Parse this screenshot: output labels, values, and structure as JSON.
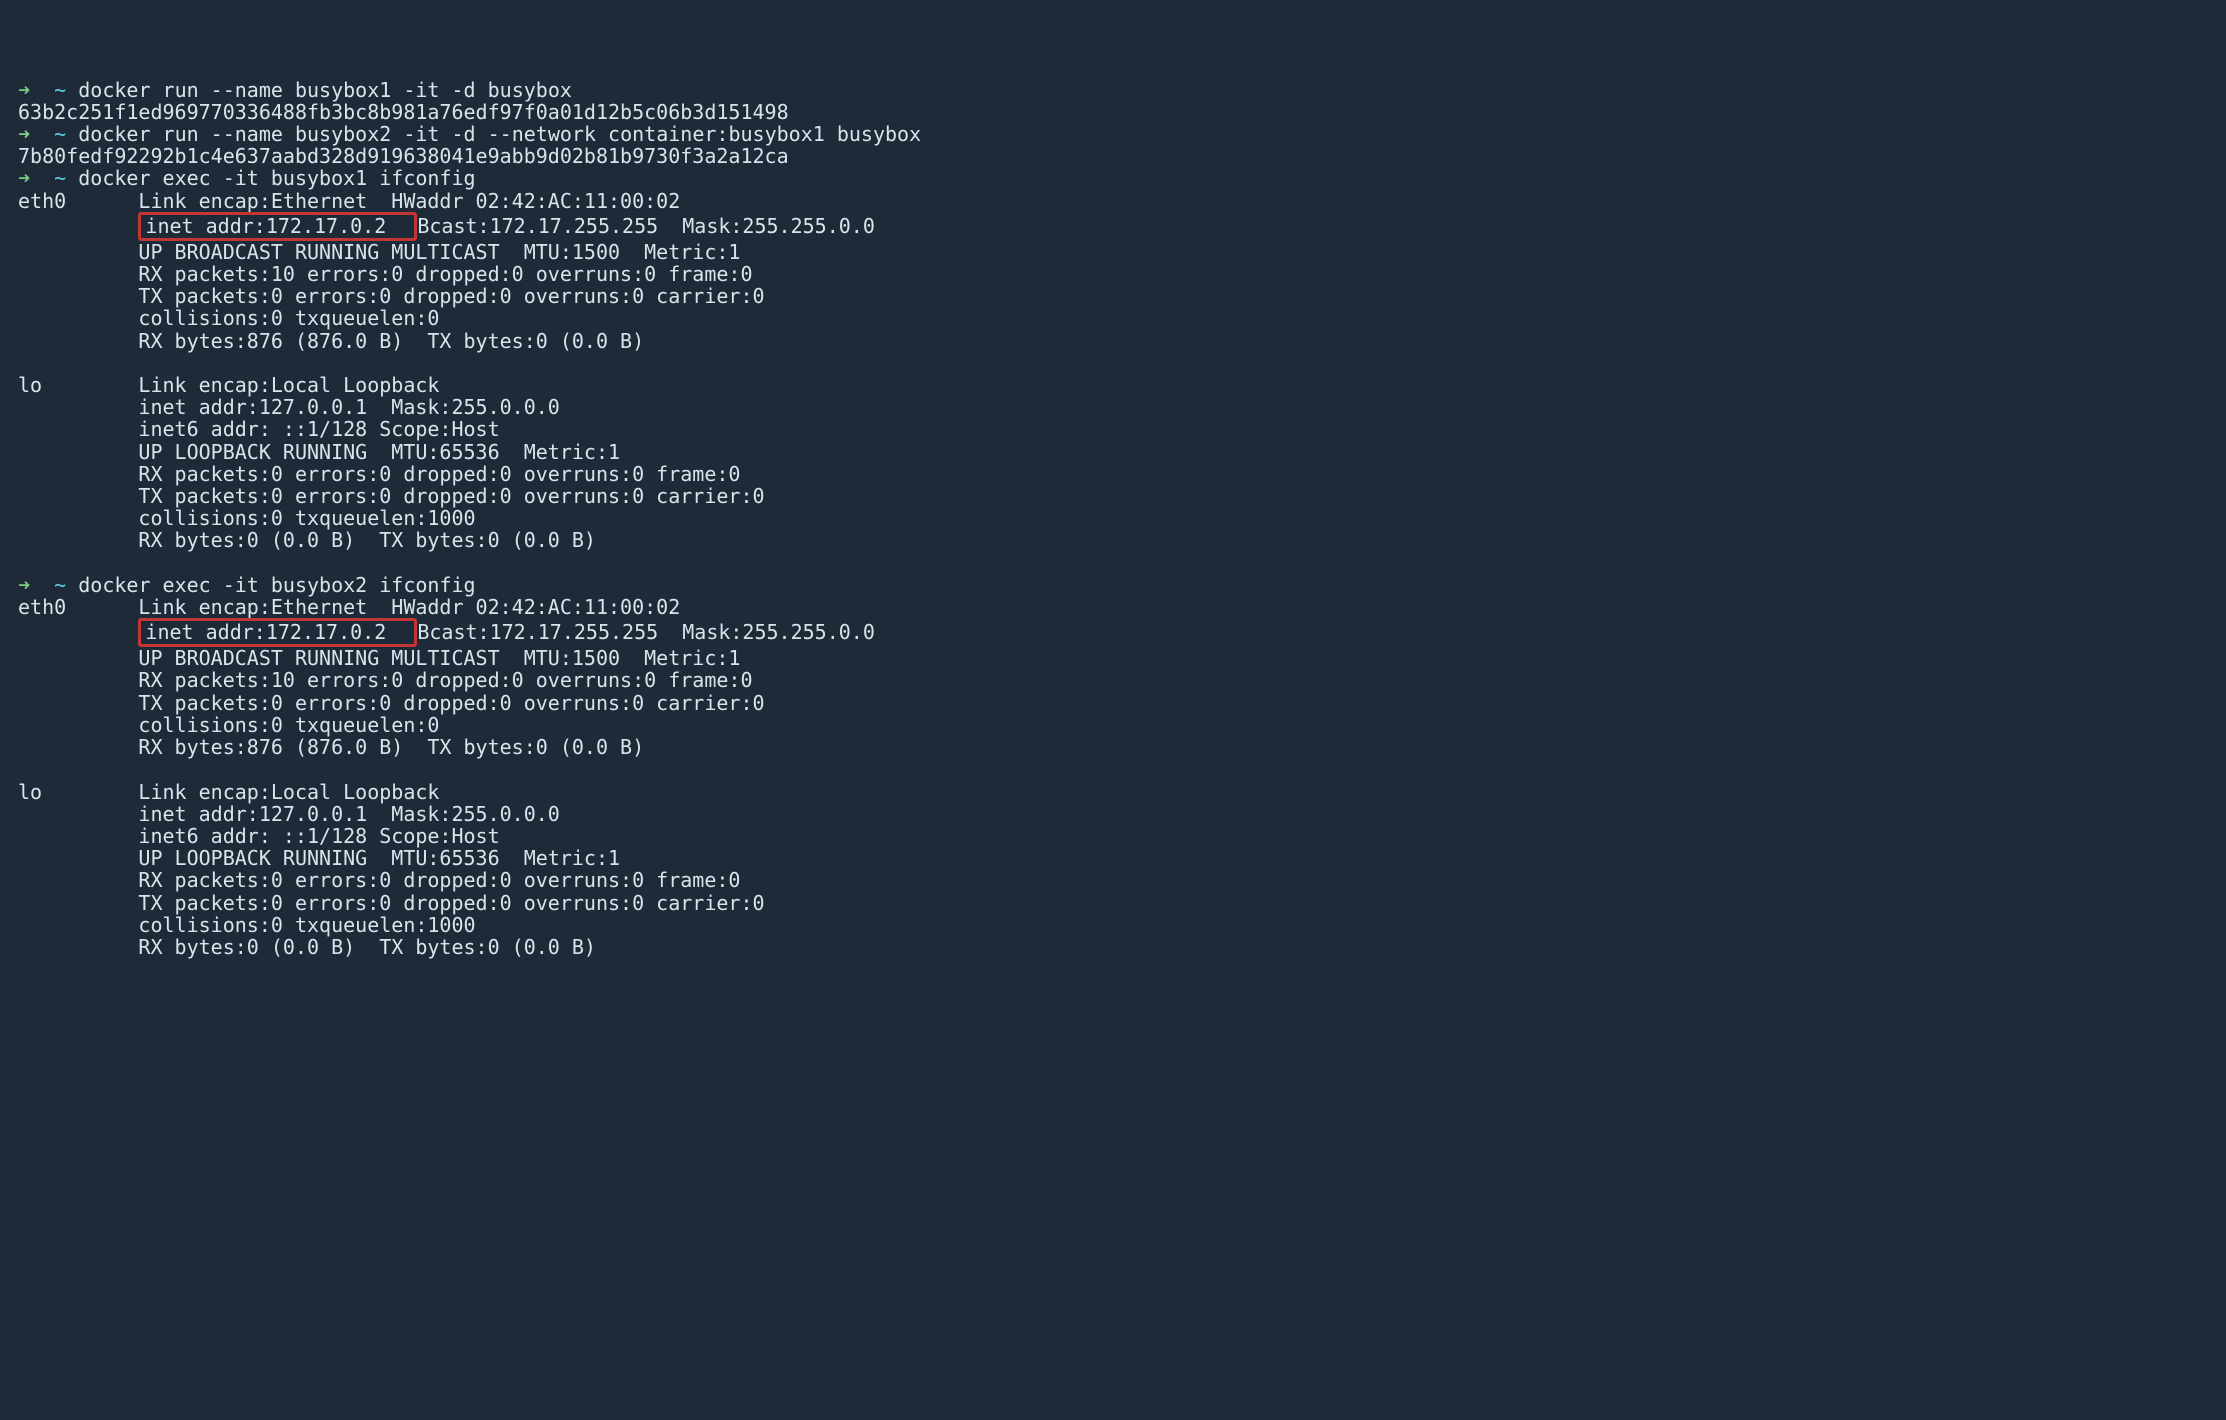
{
  "prompt": {
    "arrow": "➜",
    "tilde": "~"
  },
  "cmd1": "docker run --name busybox1 -it -d busybox",
  "out1": "63b2c251f1ed969770336488fb3bc8b981a76edf97f0a01d12b5c06b3d151498",
  "cmd2": "docker run --name busybox2 -it -d --network container:busybox1 busybox",
  "out2": "7b80fedf92292b1c4e637aabd328d919638041e9abb9d02b81b9730f3a2a12ca",
  "cmd3": "docker exec -it busybox1 ifconfig",
  "if1": {
    "eth0_l1": "eth0      Link encap:Ethernet  HWaddr 02:42:AC:11:00:02",
    "eth0_pad": "          ",
    "eth0_hl": "inet addr:172.17.0.2  ",
    "eth0_l2rest": "Bcast:172.17.255.255  Mask:255.255.0.0",
    "eth0_l3": "          UP BROADCAST RUNNING MULTICAST  MTU:1500  Metric:1",
    "eth0_l4": "          RX packets:10 errors:0 dropped:0 overruns:0 frame:0",
    "eth0_l5": "          TX packets:0 errors:0 dropped:0 overruns:0 carrier:0",
    "eth0_l6": "          collisions:0 txqueuelen:0",
    "eth0_l7": "          RX bytes:876 (876.0 B)  TX bytes:0 (0.0 B)",
    "blank": "",
    "lo_l1": "lo        Link encap:Local Loopback",
    "lo_l2": "          inet addr:127.0.0.1  Mask:255.0.0.0",
    "lo_l3": "          inet6 addr: ::1/128 Scope:Host",
    "lo_l4": "          UP LOOPBACK RUNNING  MTU:65536  Metric:1",
    "lo_l5": "          RX packets:0 errors:0 dropped:0 overruns:0 frame:0",
    "lo_l6": "          TX packets:0 errors:0 dropped:0 overruns:0 carrier:0",
    "lo_l7": "          collisions:0 txqueuelen:1000",
    "lo_l8": "          RX bytes:0 (0.0 B)  TX bytes:0 (0.0 B)"
  },
  "cmd4": "docker exec -it busybox2 ifconfig",
  "if2": {
    "eth0_l1": "eth0      Link encap:Ethernet  HWaddr 02:42:AC:11:00:02",
    "eth0_pad": "          ",
    "eth0_hl": "inet addr:172.17.0.2  ",
    "eth0_l2rest": "Bcast:172.17.255.255  Mask:255.255.0.0",
    "eth0_l3": "          UP BROADCAST RUNNING MULTICAST  MTU:1500  Metric:1",
    "eth0_l4": "          RX packets:10 errors:0 dropped:0 overruns:0 frame:0",
    "eth0_l5": "          TX packets:0 errors:0 dropped:0 overruns:0 carrier:0",
    "eth0_l6": "          collisions:0 txqueuelen:0",
    "eth0_l7": "          RX bytes:876 (876.0 B)  TX bytes:0 (0.0 B)",
    "blank": "",
    "lo_l1": "lo        Link encap:Local Loopback",
    "lo_l2": "          inet addr:127.0.0.1  Mask:255.0.0.0",
    "lo_l3": "          inet6 addr: ::1/128 Scope:Host",
    "lo_l4": "          UP LOOPBACK RUNNING  MTU:65536  Metric:1",
    "lo_l5": "          RX packets:0 errors:0 dropped:0 overruns:0 frame:0",
    "lo_l6": "          TX packets:0 errors:0 dropped:0 overruns:0 carrier:0",
    "lo_l7": "          collisions:0 txqueuelen:1000",
    "lo_l8": "          RX bytes:0 (0.0 B)  TX bytes:0 (0.0 B)"
  }
}
